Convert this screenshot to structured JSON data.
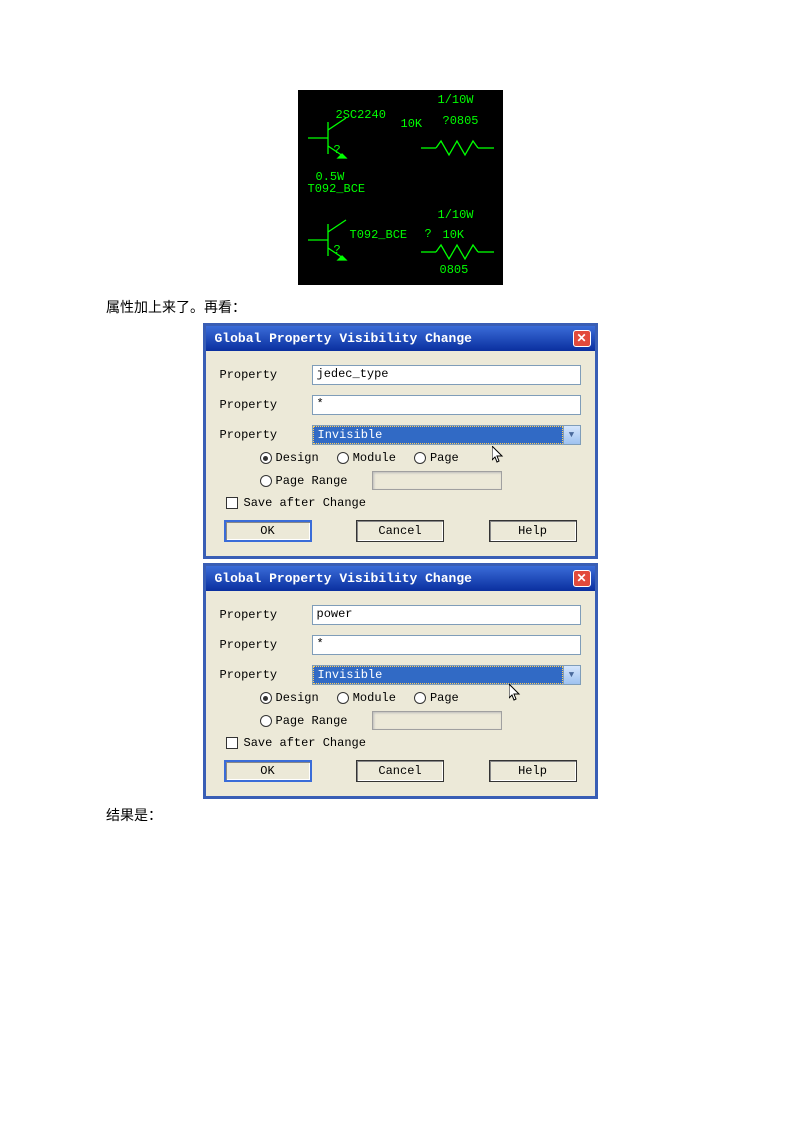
{
  "schematic": {
    "labels": {
      "w1": "1/10W",
      "part1": "2SC2240",
      "val1": "10K",
      "pkg1": "?0805",
      "q": "?",
      "w2": "0.5W",
      "pkg2": "T092_BCE",
      "w3": "1/10W",
      "pkg3": "T092_BCE",
      "val2": "10K",
      "q2": "?",
      "pkg4": "0805"
    }
  },
  "caption1": "属性加上来了。再看：",
  "dialog": {
    "title": "Global Property Visibility Change",
    "propLabel": "Property",
    "propLabel2": "Property",
    "propLabel3": "Property",
    "visValue": "Invisible",
    "radios": {
      "design": "Design",
      "module": "Module",
      "page": "Page",
      "pageRange": "Page Range"
    },
    "saveAfter": "Save after Change",
    "ok": "OK",
    "cancel": "Cancel",
    "help": "Help"
  },
  "dlg1": {
    "prop1": "jedec_type",
    "prop2": "*"
  },
  "dlg2": {
    "prop1": "power",
    "prop2": "*"
  },
  "caption2": "结果是："
}
